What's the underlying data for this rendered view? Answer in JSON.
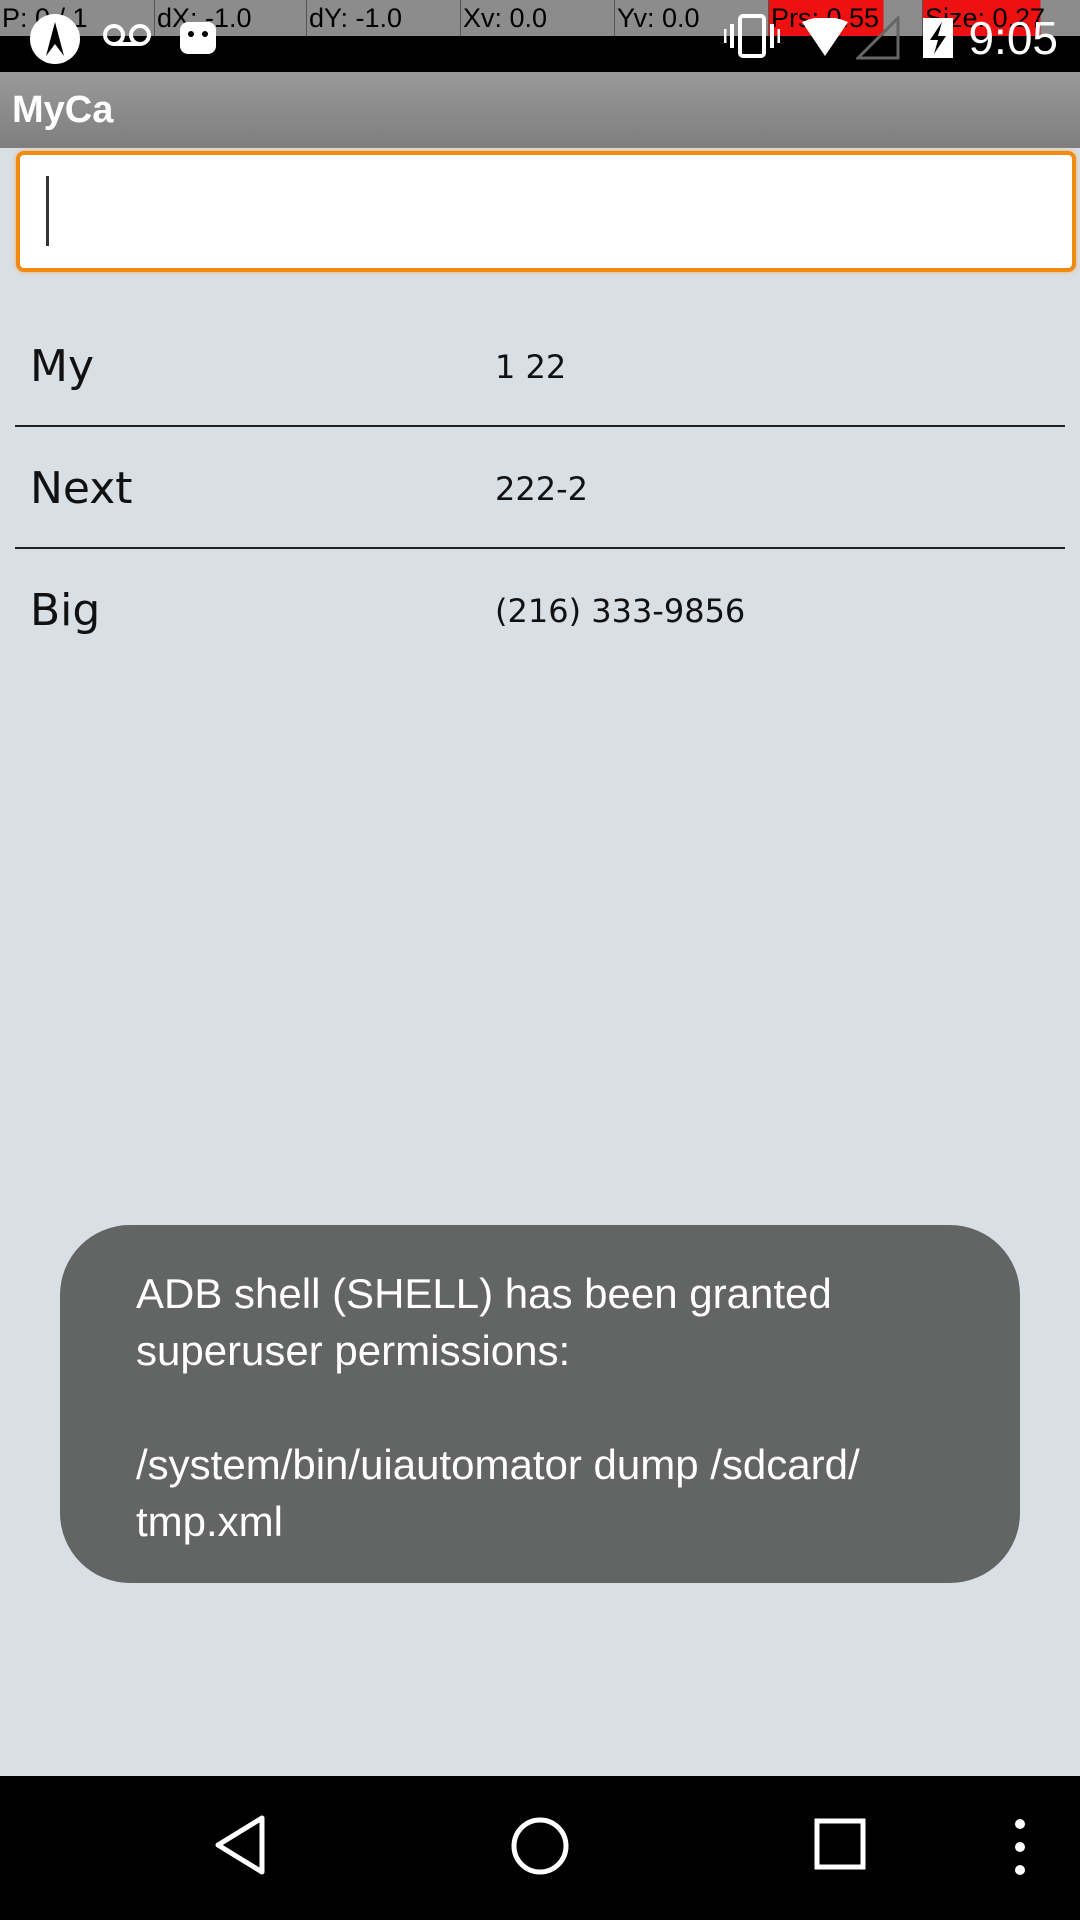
{
  "status_bar": {
    "debug": [
      "P: 0 / 1",
      "dX: -1.0",
      "dY: -1.0",
      "Xv: 0.0",
      "Yv: 0.0",
      "Prs: 0.55",
      "Size: 0.27"
    ],
    "time": "9:05",
    "icons": [
      "bug-icon",
      "voicemail-icon",
      "android-icon",
      "vibrate-icon",
      "wifi-icon",
      "no-signal-icon",
      "battery-charging-icon"
    ]
  },
  "app": {
    "title": "MyCa"
  },
  "search": {
    "value": "",
    "placeholder": ""
  },
  "contacts": [
    {
      "name": "My",
      "number": "1 22"
    },
    {
      "name": "Next",
      "number": "222-2"
    },
    {
      "name": "Big",
      "number": "(216) 333-9856"
    }
  ],
  "toast": {
    "line1": "ADB shell (SHELL) has been granted",
    "line2": "superuser permissions:",
    "line3": "/system/bin/uiautomator dump /sdcard/",
    "line4": "tmp.xml"
  },
  "nav_bar": {
    "icons": [
      "back-icon",
      "home-icon",
      "recents-icon",
      "overflow-menu-icon"
    ]
  },
  "colors": {
    "accent": "#f08a10",
    "background": "#d8dfe5",
    "toast": "#636464"
  }
}
